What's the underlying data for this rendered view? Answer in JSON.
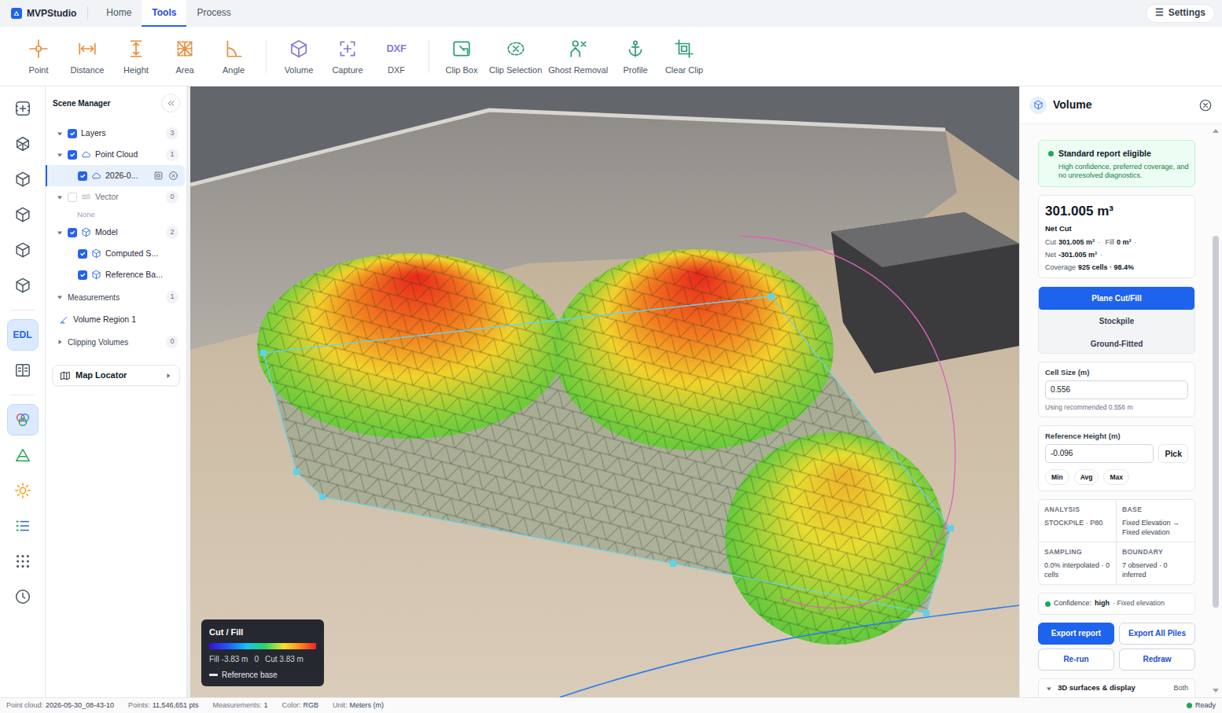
{
  "app": {
    "name": "MVPStudio"
  },
  "nav_tabs": [
    {
      "label": "Home",
      "selected": false
    },
    {
      "label": "Tools",
      "selected": true
    },
    {
      "label": "Process",
      "selected": false
    }
  ],
  "settings": {
    "icon": "☰",
    "label": "Settings"
  },
  "toolbar": {
    "groups": [
      {
        "color": "#e8903d",
        "tools": [
          {
            "label": "Point",
            "kind": "svg"
          },
          {
            "label": "Distance",
            "kind": "svg"
          },
          {
            "label": "Height",
            "kind": "svg"
          },
          {
            "label": "Area",
            "kind": "svg"
          },
          {
            "label": "Angle",
            "kind": "svg"
          }
        ]
      },
      {
        "color": "#8a7ad6",
        "tools": [
          {
            "label": "Volume",
            "kind": "svg"
          },
          {
            "label": "Capture",
            "kind": "svg"
          },
          {
            "label": "DXF",
            "kind": "text",
            "icon_text": "DXF"
          }
        ]
      },
      {
        "color": "#2f9e72",
        "tools": [
          {
            "label": "Clip Box",
            "kind": "svg"
          },
          {
            "label": "Clip Selection",
            "kind": "svg"
          },
          {
            "label": "Ghost Removal",
            "kind": "svg"
          },
          {
            "label": "Profile",
            "kind": "svg"
          },
          {
            "label": "Clear Clip",
            "kind": "svg"
          }
        ]
      }
    ]
  },
  "rail": {
    "groups": [
      {
        "items": [
          {
            "kind": "icon",
            "selected": false
          },
          {
            "kind": "icon",
            "selected": false
          },
          {
            "kind": "icon",
            "selected": false
          },
          {
            "kind": "icon",
            "selected": false
          },
          {
            "kind": "icon",
            "selected": false
          },
          {
            "kind": "icon",
            "selected": false
          }
        ]
      },
      {
        "items": [
          {
            "kind": "text",
            "label": "EDL",
            "selected": true
          },
          {
            "kind": "icon",
            "selected": false
          }
        ]
      },
      {
        "items": [
          {
            "kind": "icon",
            "selected": true
          },
          {
            "kind": "icon",
            "selected": false
          },
          {
            "kind": "icon",
            "selected": false
          },
          {
            "kind": "icon",
            "selected": false
          },
          {
            "kind": "icon",
            "selected": false
          },
          {
            "kind": "icon",
            "selected": false
          }
        ]
      }
    ]
  },
  "scene_manager": {
    "title": "Scene Manager",
    "tree": [
      {
        "label": "Layers",
        "kind": "layer-group",
        "count": "3",
        "checked": true,
        "expanded": true,
        "children": [
          {
            "label": "Point Cloud",
            "kind": "pointcloud",
            "count": "1",
            "checked": true,
            "expanded": true,
            "children": [
              {
                "label": "2026-0...",
                "kind": "pointcloud-item",
                "checked": true,
                "selected": true
              }
            ]
          },
          {
            "label": "Vector",
            "kind": "vector",
            "count": "0",
            "checked": false,
            "disabled": true,
            "expanded": true,
            "empty_text": "None"
          },
          {
            "label": "Model",
            "kind": "model",
            "count": "2",
            "checked": true,
            "expanded": true,
            "children": [
              {
                "label": "Computed S...",
                "kind": "model-item",
                "checked": true
              },
              {
                "label": "Reference Ba...",
                "kind": "model-item",
                "checked": true
              }
            ]
          }
        ]
      },
      {
        "label": "Measurements",
        "kind": "section",
        "count": "1",
        "expanded": true,
        "children": [
          {
            "label": "Volume Region 1",
            "kind": "measurement"
          }
        ]
      },
      {
        "label": "Clipping Volumes",
        "kind": "section",
        "count": "0",
        "expanded": false
      }
    ],
    "map_locator": {
      "label": "Map Locator",
      "expanded": false
    }
  },
  "viewport": {
    "legend": {
      "title": "Cut / Fill",
      "min": "Fill -3.83 m",
      "mid": "0",
      "max": "Cut 3.83 m",
      "base": "Reference base"
    }
  },
  "volume_panel": {
    "title": "Volume",
    "eligibility": {
      "title": "Standard report eligible",
      "detail": "High confidence, preferred coverage, and no unresolved diagnostics."
    },
    "result": {
      "value": "301.005 m³",
      "label": "Net Cut",
      "separator": "·",
      "metrics": [
        {
          "label": "Cut",
          "value": "301.005 m³"
        },
        {
          "label": "Fill",
          "value": "0 m³"
        },
        {
          "label": "Net",
          "value": "-301.005 m³"
        },
        {
          "label": "Coverage",
          "value": "925 cells · 98.4%"
        }
      ]
    },
    "modes": [
      {
        "label": "Plane Cut/Fill",
        "selected": true
      },
      {
        "label": "Stockpile",
        "selected": false
      },
      {
        "label": "Ground-Fitted",
        "selected": false
      }
    ],
    "cell_size": {
      "label": "Cell Size (m)",
      "value": "0.556",
      "hint": "Using recommended 0.556 m"
    },
    "reference_height": {
      "label": "Reference Height (m)",
      "value": "-0.096",
      "pick": "Pick",
      "presets": [
        "Min",
        "Avg",
        "Max"
      ]
    },
    "summary": [
      {
        "label": "ANALYSIS",
        "value": "STOCKPILE · P80"
      },
      {
        "label": "BASE",
        "value": "Fixed Elevation → Fixed elevation"
      },
      {
        "label": "SAMPLING",
        "value": "0.0% interpolated · 0 cells"
      },
      {
        "label": "BOUNDARY",
        "value": "7 observed · 0 inferred"
      }
    ],
    "confidence": {
      "label": "Confidence:",
      "level": "high",
      "detail": "· Fixed elevation"
    },
    "actions": [
      {
        "label": "Export report",
        "kind": "primary"
      },
      {
        "label": "Export All Piles",
        "kind": "outline"
      },
      {
        "label": "Re-run",
        "kind": "outline"
      },
      {
        "label": "Redraw",
        "kind": "outline"
      }
    ],
    "section": {
      "label": "3D surfaces & display",
      "value": "Both",
      "expanded": true
    },
    "scrollbar": {
      "offset": 0.19,
      "level": 0.66
    }
  },
  "status_bar": {
    "items": [
      {
        "label": "Point cloud:",
        "value": "2026-05-30_08-43-10"
      },
      {
        "label": "Points:",
        "value": "11,546,651 pts"
      },
      {
        "label": "Measurements:",
        "value": "1"
      },
      {
        "label": "Color:",
        "value": "RGB"
      },
      {
        "label": "Unit:",
        "value": "Meters (m)"
      }
    ],
    "state": "Ready"
  }
}
